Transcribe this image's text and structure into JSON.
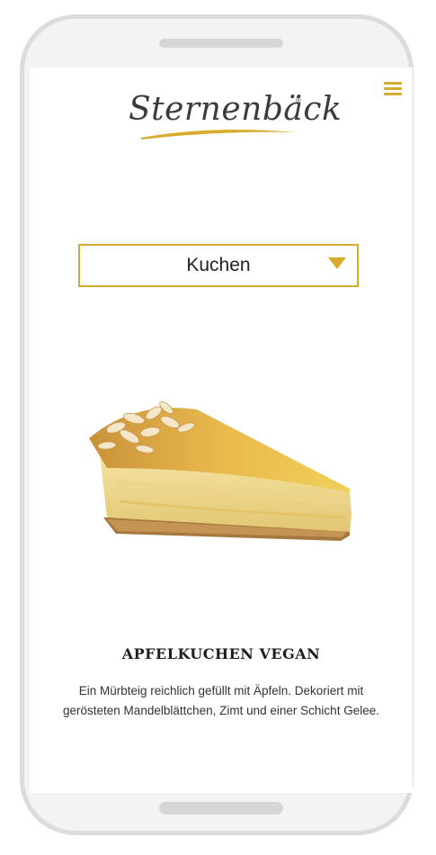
{
  "brand": {
    "logo_text": "Sternenbäck",
    "logo_mark": "®"
  },
  "header": {
    "menu_icon": "hamburger-icon",
    "accent_color": "#d7ab2c"
  },
  "category_select": {
    "selected": "Kuchen",
    "arrow_icon": "triangle-down-icon"
  },
  "product": {
    "name": "APFELKUCHEN VEGAN",
    "description": "Ein Mürbteig reichlich gefüllt mit Äpfeln. Dekoriert mit gerösteten Mandelblättchen, Zimt und einer Schicht Gelee.",
    "image": "apple-cake-slice"
  }
}
